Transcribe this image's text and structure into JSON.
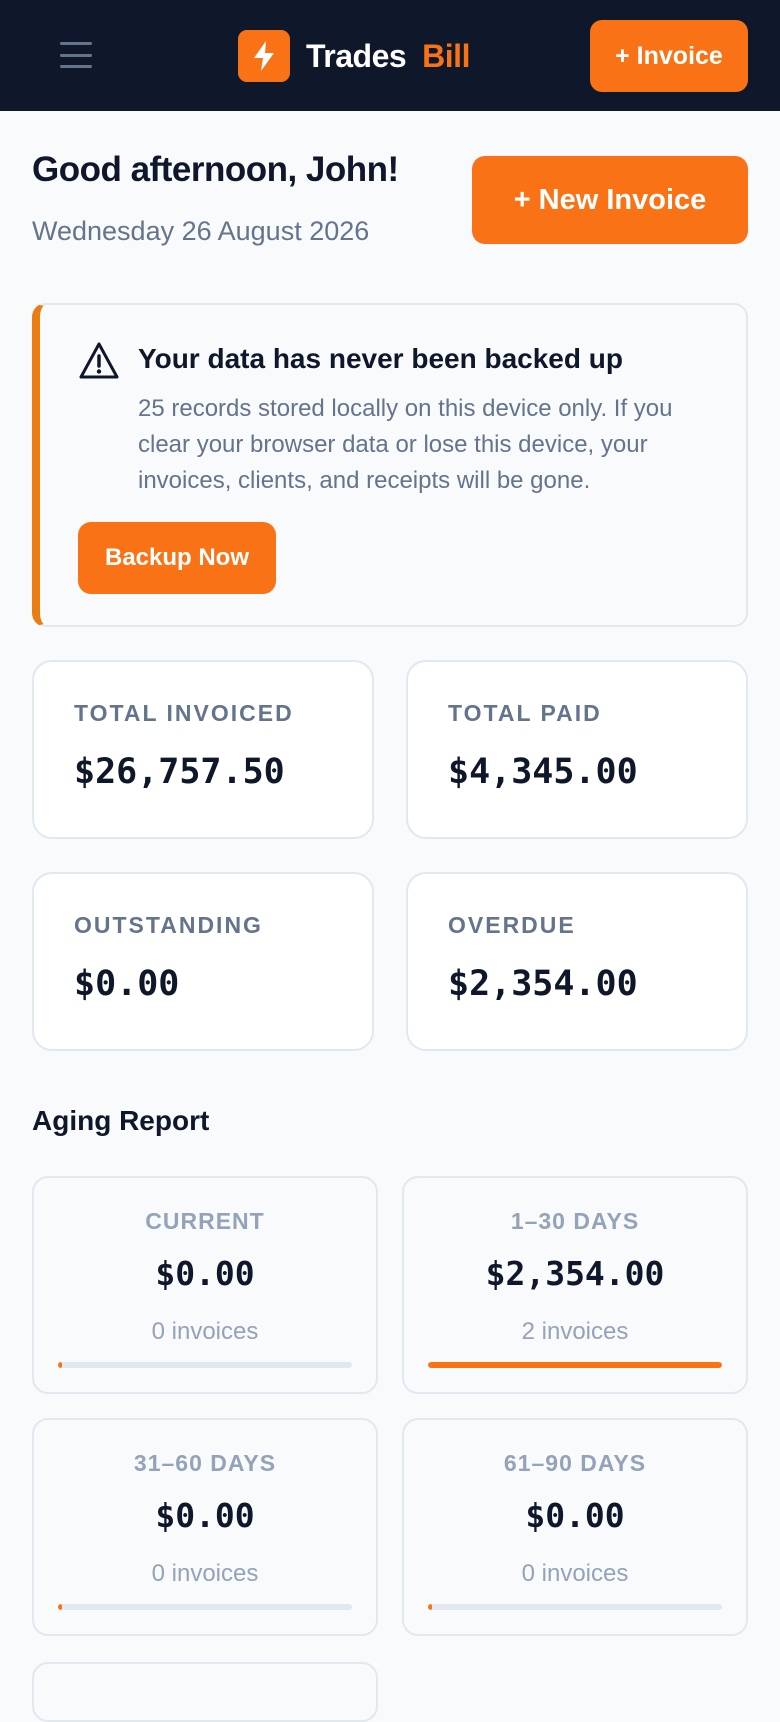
{
  "header": {
    "brand_primary": "Trades",
    "brand_accent": "Bill",
    "invoice_button": "+ Invoice",
    "logo_icon": "lightning-bolt-icon",
    "menu_icon": "hamburger-menu-icon"
  },
  "greeting": {
    "title": "Good afternoon, John!",
    "date": "Wednesday 26 August 2026",
    "new_invoice_button": "+ New Invoice"
  },
  "backup_alert": {
    "icon": "warning-triangle-icon",
    "title": "Your data has never been backed up",
    "body": "25 records stored locally on this device only. If you clear your browser data or lose this device, your invoices, clients, and receipts will be gone.",
    "button": "Backup Now"
  },
  "stats": [
    {
      "label": "TOTAL INVOICED",
      "value": "$26,757.50"
    },
    {
      "label": "TOTAL PAID",
      "value": "$4,345.00"
    },
    {
      "label": "OUTSTANDING",
      "value": "$0.00"
    },
    {
      "label": "OVERDUE",
      "value": "$2,354.00"
    }
  ],
  "aging": {
    "title": "Aging Report",
    "buckets": [
      {
        "label": "CURRENT",
        "value": "$0.00",
        "count": "0 invoices",
        "fraction": 0
      },
      {
        "label": "1–30 DAYS",
        "value": "$2,354.00",
        "count": "2 invoices",
        "fraction": 1
      },
      {
        "label": "31–60 DAYS",
        "value": "$0.00",
        "count": "0 invoices",
        "fraction": 0
      },
      {
        "label": "61–90 DAYS",
        "value": "$0.00",
        "count": "0 invoices",
        "fraction": 0
      }
    ]
  },
  "colors": {
    "accent": "#f97316",
    "navbar": "#0f172a",
    "alert_border": "#ea7d12"
  }
}
